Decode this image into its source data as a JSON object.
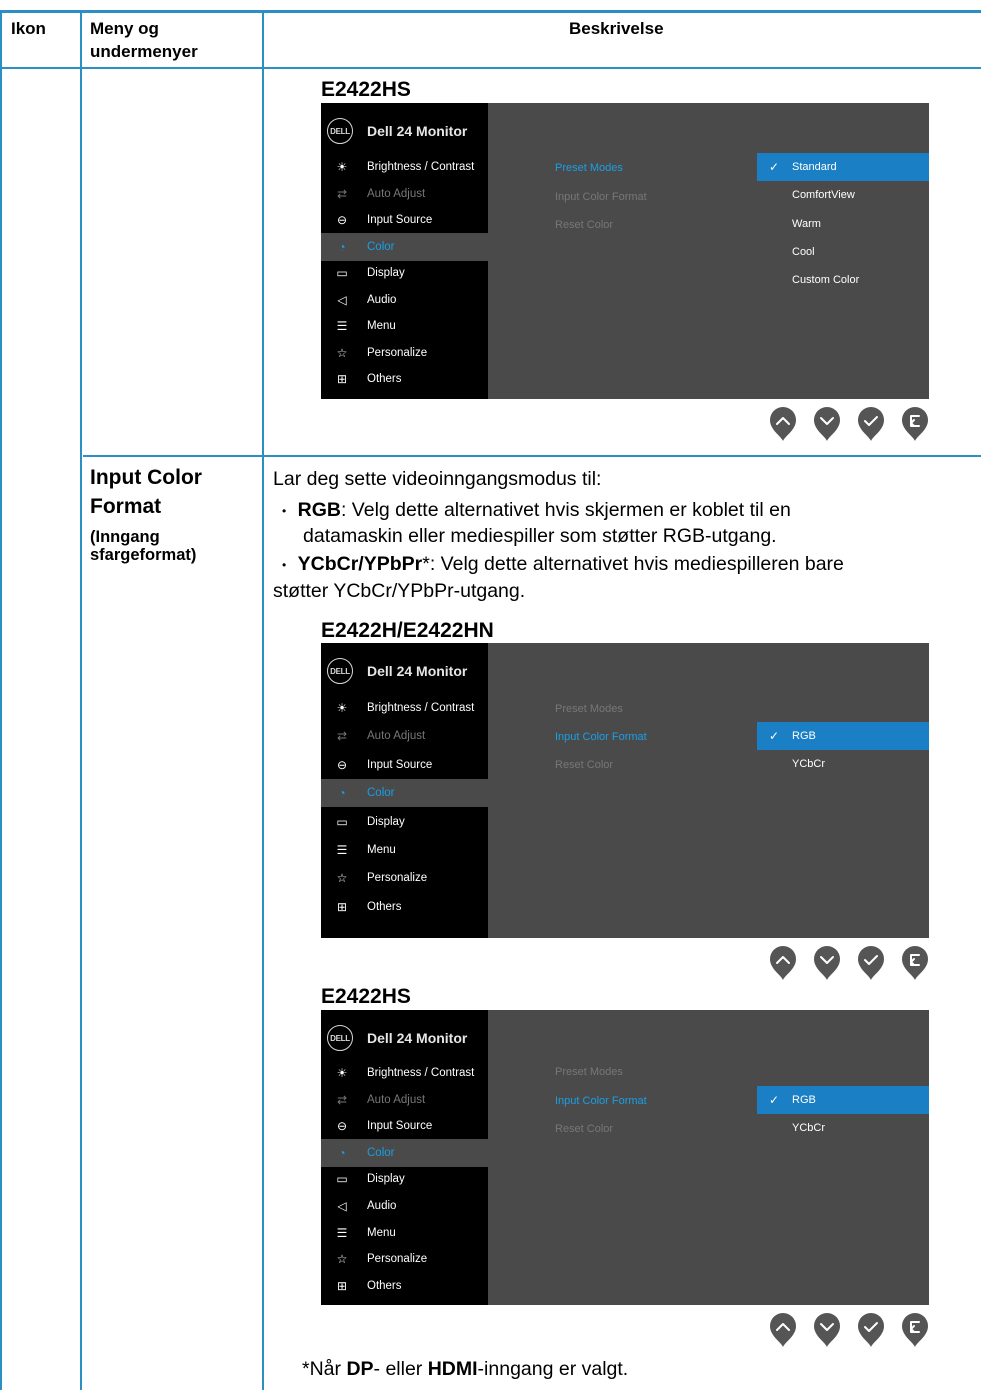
{
  "header": {
    "col_icon": "Ikon",
    "col_menu_line1": "Meny og",
    "col_menu_line2": "undermenyer",
    "col_desc": "Beskrivelse"
  },
  "section1": {
    "model": "E2422HS",
    "osd": {
      "title": "Dell 24 Monitor",
      "logo": "DELL",
      "menu": [
        {
          "label": "Brightness / Contrast",
          "icon": "brightness-icon",
          "state": "normal"
        },
        {
          "label": "Auto Adjust",
          "icon": "auto-adjust-icon",
          "state": "dim"
        },
        {
          "label": "Input Source",
          "icon": "input-source-icon",
          "state": "normal"
        },
        {
          "label": "Color",
          "icon": "color-icon",
          "state": "selected"
        },
        {
          "label": "Display",
          "icon": "display-icon",
          "state": "normal"
        },
        {
          "label": "Audio",
          "icon": "audio-icon",
          "state": "normal"
        },
        {
          "label": "Menu",
          "icon": "menu-icon",
          "state": "normal"
        },
        {
          "label": "Personalize",
          "icon": "star-icon",
          "state": "normal"
        },
        {
          "label": "Others",
          "icon": "others-icon",
          "state": "normal"
        }
      ],
      "submenu": [
        "Preset Modes",
        "Input Color Format",
        "Reset Color"
      ],
      "options": [
        "Standard",
        "ComfortView",
        "Warm",
        "Cool",
        "Custom Color"
      ]
    }
  },
  "section2": {
    "menu_title_line1": "Input Color",
    "menu_title_line2": "Format",
    "menu_sub_line1": "(Inngang",
    "menu_sub_line2": "sfargeformat)",
    "intro": "Lar deg sette videoinngangsmodus til:",
    "bullet1_bold": "RGB",
    "bullet1_text": ": Velg dette alternativet hvis skjermen er koblet til en",
    "bullet1_line2": "datamaskin eller mediespiller som støtter RGB-utgang.",
    "bullet2_bold": "YCbCr/YPbPr",
    "bullet2_star": "*",
    "bullet2_text": ": Velg dette alternativet hvis mediespilleren bare",
    "bullet2_line2": "støtter YCbCr/YPbPr-utgang.",
    "model_a": "E2422H/E2422HN",
    "osd_a": {
      "title": "Dell 24 Monitor",
      "logo": "DELL",
      "menu": [
        {
          "label": "Brightness / Contrast",
          "icon": "brightness-icon",
          "state": "normal"
        },
        {
          "label": "Auto Adjust",
          "icon": "auto-adjust-icon",
          "state": "dim"
        },
        {
          "label": "Input Source",
          "icon": "input-source-icon",
          "state": "normal"
        },
        {
          "label": "Color",
          "icon": "color-icon",
          "state": "selected"
        },
        {
          "label": "Display",
          "icon": "display-icon",
          "state": "normal"
        },
        {
          "label": "Menu",
          "icon": "menu-icon",
          "state": "normal"
        },
        {
          "label": "Personalize",
          "icon": "star-icon",
          "state": "normal"
        },
        {
          "label": "Others",
          "icon": "others-icon",
          "state": "normal"
        }
      ],
      "submenu": [
        "Preset Modes",
        "Input Color Format",
        "Reset Color"
      ],
      "options": [
        "RGB",
        "YCbCr"
      ]
    },
    "model_b": "E2422HS",
    "osd_b": {
      "title": "Dell 24 Monitor",
      "logo": "DELL",
      "menu": [
        {
          "label": "Brightness / Contrast",
          "icon": "brightness-icon",
          "state": "normal"
        },
        {
          "label": "Auto Adjust",
          "icon": "auto-adjust-icon",
          "state": "dim"
        },
        {
          "label": "Input Source",
          "icon": "input-source-icon",
          "state": "normal"
        },
        {
          "label": "Color",
          "icon": "color-icon",
          "state": "selected"
        },
        {
          "label": "Display",
          "icon": "display-icon",
          "state": "normal"
        },
        {
          "label": "Audio",
          "icon": "audio-icon",
          "state": "normal"
        },
        {
          "label": "Menu",
          "icon": "menu-icon",
          "state": "normal"
        },
        {
          "label": "Personalize",
          "icon": "star-icon",
          "state": "normal"
        },
        {
          "label": "Others",
          "icon": "others-icon",
          "state": "normal"
        }
      ],
      "submenu": [
        "Preset Modes",
        "Input Color Format",
        "Reset Color"
      ],
      "options": [
        "RGB",
        "YCbCr"
      ]
    },
    "footnote_star": "*",
    "footnote_a": "Når ",
    "footnote_dp": "DP",
    "footnote_b": "- eller ",
    "footnote_hdmi": "HDMI",
    "footnote_c": "-inngang er valgt."
  },
  "colors": {
    "rule": "#2b8fc4",
    "osd_bg": "#4a4a4a",
    "osd_side": "#000000",
    "highlight": "#1a7fc4",
    "selected_text": "#1a9fe6"
  },
  "nav_buttons": [
    "up-icon",
    "down-icon",
    "check-icon",
    "back-icon"
  ]
}
